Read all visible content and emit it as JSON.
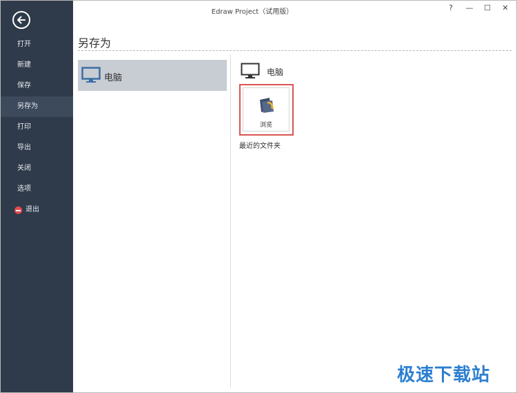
{
  "window": {
    "title": "Edraw Project（试用版）"
  },
  "window_controls": {
    "help": "?",
    "minimize": "—",
    "maximize": "☐",
    "close": "✕"
  },
  "sidebar": {
    "items": [
      {
        "label": "打开"
      },
      {
        "label": "新建"
      },
      {
        "label": "保存"
      },
      {
        "label": "另存为"
      },
      {
        "label": "打印"
      },
      {
        "label": "导出"
      },
      {
        "label": "关闭"
      },
      {
        "label": "选项"
      },
      {
        "label": "退出"
      }
    ],
    "active": "另存为",
    "icons": {
      "back": "back-arrow-icon",
      "exit": "exit-icon"
    }
  },
  "main": {
    "page_title": "另存为",
    "locations": [
      {
        "label": "电脑",
        "icon": "monitor-icon"
      }
    ],
    "detail": {
      "heading": "电脑",
      "browse_label": "浏览",
      "recent_label": "最近的文件夹"
    }
  },
  "watermark": "极速下载站",
  "colors": {
    "sidebar": "#2f3a4a",
    "sidebar_active": "#3d4a5c",
    "selected_location": "#c8ccd3",
    "highlight_border": "#d9534f",
    "accent": "#3a6ea5"
  }
}
